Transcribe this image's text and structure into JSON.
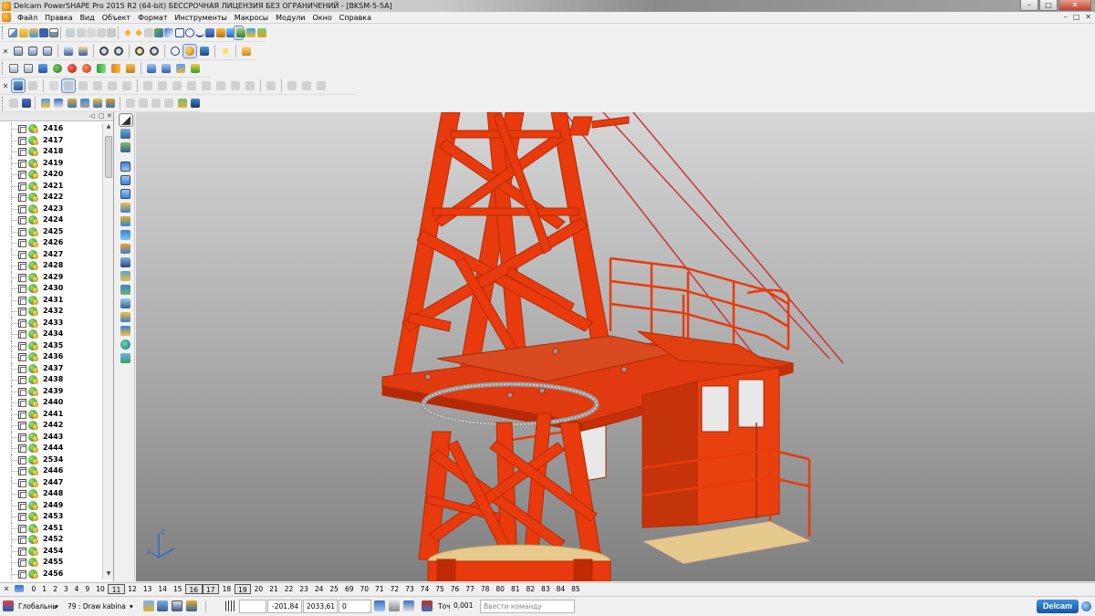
{
  "window": {
    "title": "Delcam PowerSHAPE Pro 2015 R2 (64-bit) БЕССРОЧНАЯ ЛИЦЕНЗИЯ БЕЗ ОГРАНИЧЕНИЙ - [BKSM-5-5A]",
    "minimize": "–",
    "maximize": "□",
    "close": "✕"
  },
  "menu": {
    "items": [
      "Файл",
      "Правка",
      "Вид",
      "Объект",
      "Формат",
      "Инструменты",
      "Макросы",
      "Модули",
      "Окно",
      "Справка"
    ],
    "mdi_controls": [
      "–",
      "□",
      "✕"
    ]
  },
  "tree": {
    "header_controls": [
      "◁",
      "▢",
      "✕"
    ],
    "items": [
      "2416",
      "2417",
      "2418",
      "2419",
      "2420",
      "2421",
      "2422",
      "2423",
      "2424",
      "2425",
      "2426",
      "2427",
      "2428",
      "2429",
      "2430",
      "2431",
      "2432",
      "2433",
      "2434",
      "2435",
      "2436",
      "2437",
      "2438",
      "2439",
      "2440",
      "2441",
      "2442",
      "2443",
      "2444",
      "2534",
      "2446",
      "2447",
      "2448",
      "2449",
      "2453",
      "2451",
      "2452",
      "2454",
      "2455",
      "2456"
    ],
    "scroll_up": "▲",
    "scroll_down": "▼"
  },
  "layers": {
    "numbers": [
      "0",
      "1",
      "2",
      "3",
      "4",
      "9",
      "10",
      "11",
      "12",
      "13",
      "14",
      "15",
      "16",
      "17",
      "18",
      "19",
      "20",
      "21",
      "22",
      "23",
      "24",
      "25",
      "69",
      "70",
      "71",
      "72",
      "73",
      "74",
      "75",
      "76",
      "77",
      "78",
      "80",
      "81",
      "82",
      "83",
      "84",
      "85"
    ],
    "boxed": [
      "11",
      "16",
      "17",
      "19"
    ]
  },
  "status": {
    "workplane": "Глобальнь",
    "level": "79 : Draw kabina",
    "x": "-201,84",
    "y": "2033,61",
    "z": "0",
    "tolerance_label": "Точ",
    "tolerance_value": "0,001",
    "command_placeholder": "Ввести команду",
    "logo": "Delcam"
  },
  "colors": {
    "crane_red": "#e83a0c",
    "crane_red_dark": "#b82a05",
    "floor_wood": "#e6c98d",
    "viewport_top": "#d6d6d6",
    "viewport_bottom": "#7f7f7f"
  },
  "axis": {
    "z": "Z",
    "x": "X"
  }
}
